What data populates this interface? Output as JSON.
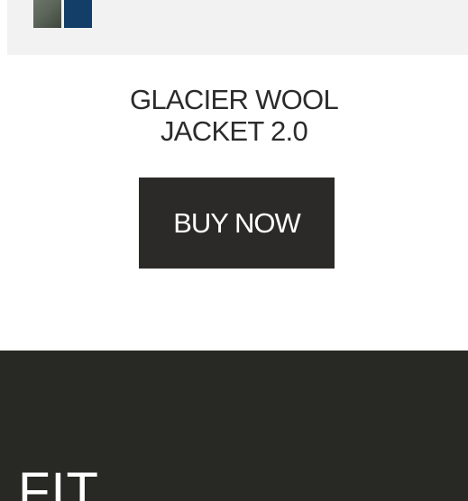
{
  "product": {
    "title_line1": "GLACIER WOOL",
    "title_line2": "JACKET 2.0",
    "buy_label": "BUY NOW",
    "swatches": [
      {
        "name": "grey",
        "color": "#5c6559"
      },
      {
        "name": "navy",
        "color": "#123e67"
      }
    ]
  },
  "footer": {
    "heading": "FIT"
  },
  "colors": {
    "button_bg": "#2b2a28",
    "footer_bg": "#282825",
    "image_bg": "#f2f2f2"
  }
}
